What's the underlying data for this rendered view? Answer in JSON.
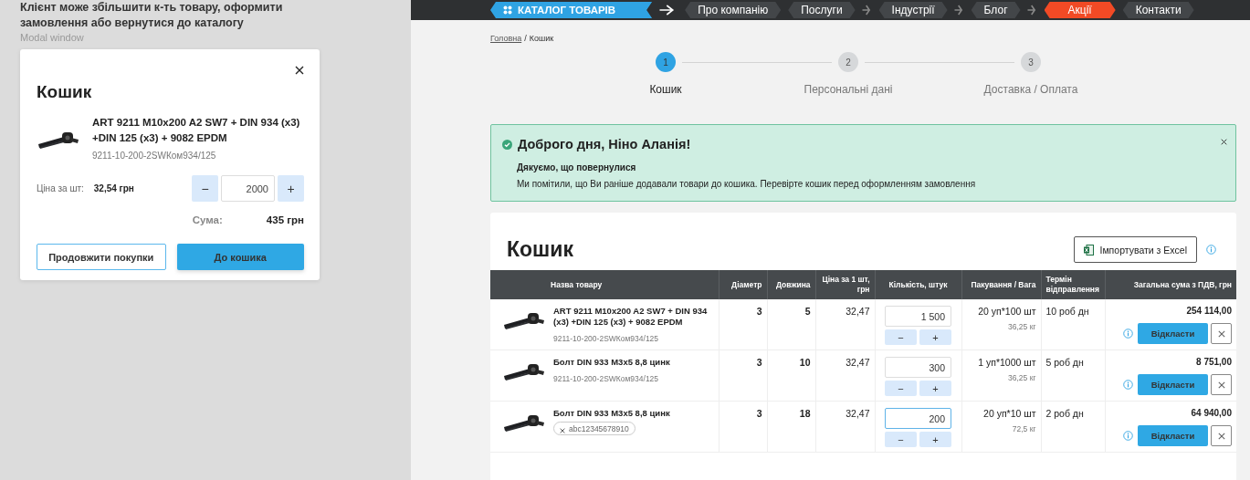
{
  "annotation": {
    "title": "Клієнт може збільшити к-ть товару, оформити замовлення або вернутися до каталогу",
    "subtitle": "Modal window"
  },
  "modal": {
    "title": "Кошик",
    "product_name": "ART 9211 M10x200 A2 SW7 + DIN 934 (x3) +DIN 125 (x3) + 9082 EPDM",
    "sku": "9211-10-200-2SWКом934/125",
    "price_label": "Ціна за шт:",
    "price": "32,54 грн",
    "minus": "−",
    "quantity": "2000",
    "plus": "+",
    "sum_label": "Сума:",
    "sum": "435 грн",
    "buttons": [
      {
        "label": "Продовжити покупки",
        "kind": "secondary"
      },
      {
        "label": "До кошика",
        "kind": "primary"
      }
    ]
  },
  "nav": {
    "catalog": "КАТАЛОГ ТОВАРІВ",
    "items": [
      {
        "label": "Про компанію",
        "selected": false,
        "arrow_after": false
      },
      {
        "label": "Послуги",
        "selected": false,
        "arrow_after": true
      },
      {
        "label": "Індустрії",
        "selected": false,
        "arrow_after": true
      },
      {
        "label": "Блог",
        "selected": false,
        "arrow_after": true
      },
      {
        "label": "Акції",
        "selected": true,
        "arrow_after": false
      },
      {
        "label": "Контакти",
        "selected": false,
        "arrow_after": false
      }
    ]
  },
  "breadcrumb": {
    "link": "Головна",
    "separator": "/",
    "current": "Кошик"
  },
  "steps": [
    {
      "number": "1",
      "label": "Кошик",
      "selected": true
    },
    {
      "number": "2",
      "label": "Персональні дані",
      "selected": false
    },
    {
      "number": "3",
      "label": "Доставка / Оплата",
      "selected": false
    }
  ],
  "alert": {
    "title": "Доброго дня, Ніно Аланія!",
    "subtitle": "Дякуємо, що повернулися",
    "message": "Ми помітили, що Ви раніше додавали товари до кошика. Перевірте кошик перед оформленням замовлення"
  },
  "cart": {
    "title": "Кошик",
    "import_button": "Імпортувати з Excel",
    "columns": [
      "Назва товару",
      "Діаметр",
      "Довжина",
      "Ціна за 1 шт, грн",
      "Кількість, штук",
      "Пакування / Вага",
      "Термін відправлення",
      "Загальна сума з ПДВ, грн"
    ],
    "rows": [
      {
        "name": "ART 9211 M10x200 A2 SW7 + DIN 934 (x3) +DIN 125 (x3) + 9082 EPDM",
        "sku": "9211-10-200-2SWКом934/125",
        "diameter": "3",
        "length": "5",
        "price": "32,47",
        "quantity": "1 500",
        "focused": false,
        "minus": "−",
        "plus": "+",
        "packing": "20 уп*100 шт",
        "weight": "36,25 кг",
        "term": "10 роб дн",
        "total": "254 114,00",
        "button": "Відкласти"
      },
      {
        "name": "Болт DIN 933 M3x5 8,8 цинк",
        "sku": "9211-10-200-2SWКом934/125",
        "diameter": "3",
        "length": "10",
        "price": "32,47",
        "quantity": "300",
        "focused": false,
        "minus": "−",
        "plus": "+",
        "packing": "1 уп*1000 шт",
        "weight": "36,25 кг",
        "term": "5 роб дн",
        "total": "8 751,00",
        "button": "Відкласти"
      },
      {
        "name": "Болт DIN 933 M3x5 8,8 цинк",
        "tag": "abc12345678910",
        "diameter": "3",
        "length": "18",
        "price": "32,47",
        "quantity": "200",
        "focused": true,
        "minus": "−",
        "plus": "+",
        "packing": "20 уп*10 шт",
        "weight": "72,5 кг",
        "term": "2 роб дн",
        "total": "64 940,00",
        "button": "Відкласти"
      }
    ]
  }
}
